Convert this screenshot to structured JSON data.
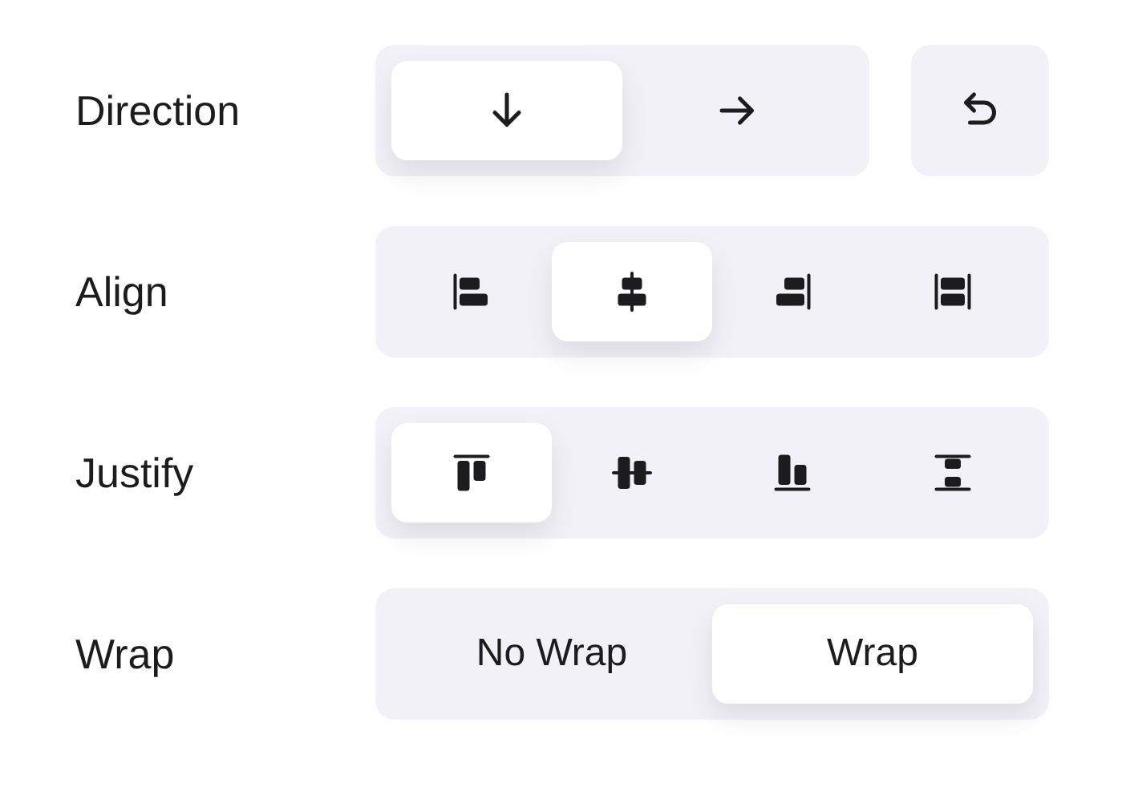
{
  "rows": [
    {
      "label": "Direction",
      "options": [
        {
          "kind": "arrow-down",
          "selected": true
        },
        {
          "kind": "arrow-right",
          "selected": false
        }
      ],
      "reset": {
        "kind": "undo"
      }
    },
    {
      "label": "Align",
      "options": [
        {
          "kind": "align-start",
          "selected": false
        },
        {
          "kind": "align-center",
          "selected": true
        },
        {
          "kind": "align-end",
          "selected": false
        },
        {
          "kind": "align-stretch",
          "selected": false
        }
      ]
    },
    {
      "label": "Justify",
      "options": [
        {
          "kind": "justify-start",
          "selected": true
        },
        {
          "kind": "justify-center",
          "selected": false
        },
        {
          "kind": "justify-end",
          "selected": false
        },
        {
          "kind": "justify-between",
          "selected": false
        }
      ]
    },
    {
      "label": "Wrap",
      "options": [
        {
          "text": "No Wrap",
          "selected": false
        },
        {
          "text": "Wrap",
          "selected": true
        }
      ]
    }
  ]
}
